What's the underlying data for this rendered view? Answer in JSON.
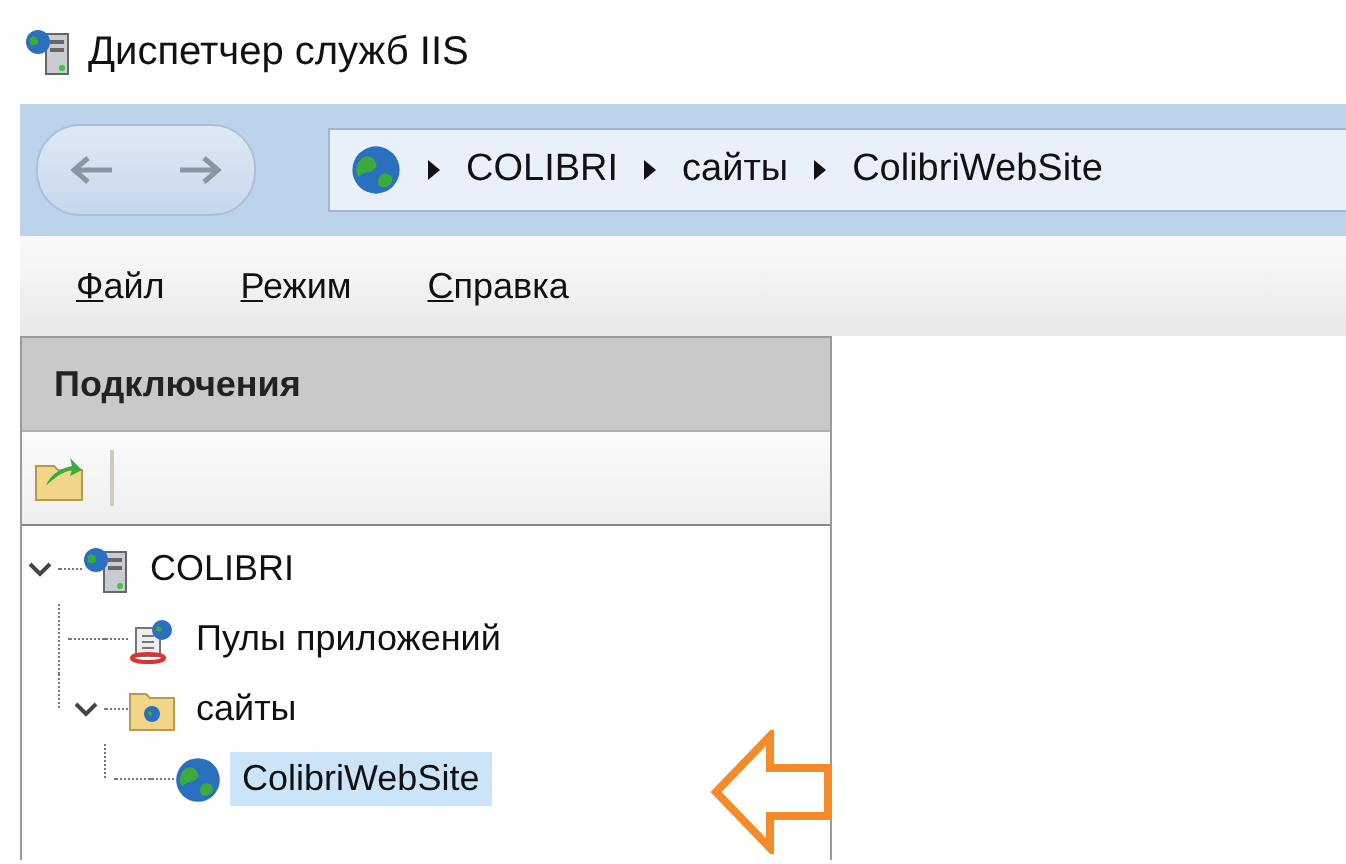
{
  "window": {
    "title": "Диспетчер служб IIS"
  },
  "address_bar": {
    "crumbs": [
      "COLIBRI",
      "сайты",
      "ColibriWebSite"
    ]
  },
  "menu": [
    "Файл",
    "Режим",
    "Справка"
  ],
  "connections": {
    "title": "Подключения",
    "tree": [
      {
        "label": "COLIBRI",
        "kind": "server",
        "expanded": true,
        "selected": false,
        "children": [
          {
            "label": "Пулы приложений",
            "kind": "pools",
            "selected": false
          },
          {
            "label": "сайты",
            "kind": "folder",
            "expanded": true,
            "selected": false,
            "children": [
              {
                "label": "ColibriWebSite",
                "kind": "site",
                "selected": true
              }
            ]
          }
        ]
      }
    ]
  }
}
